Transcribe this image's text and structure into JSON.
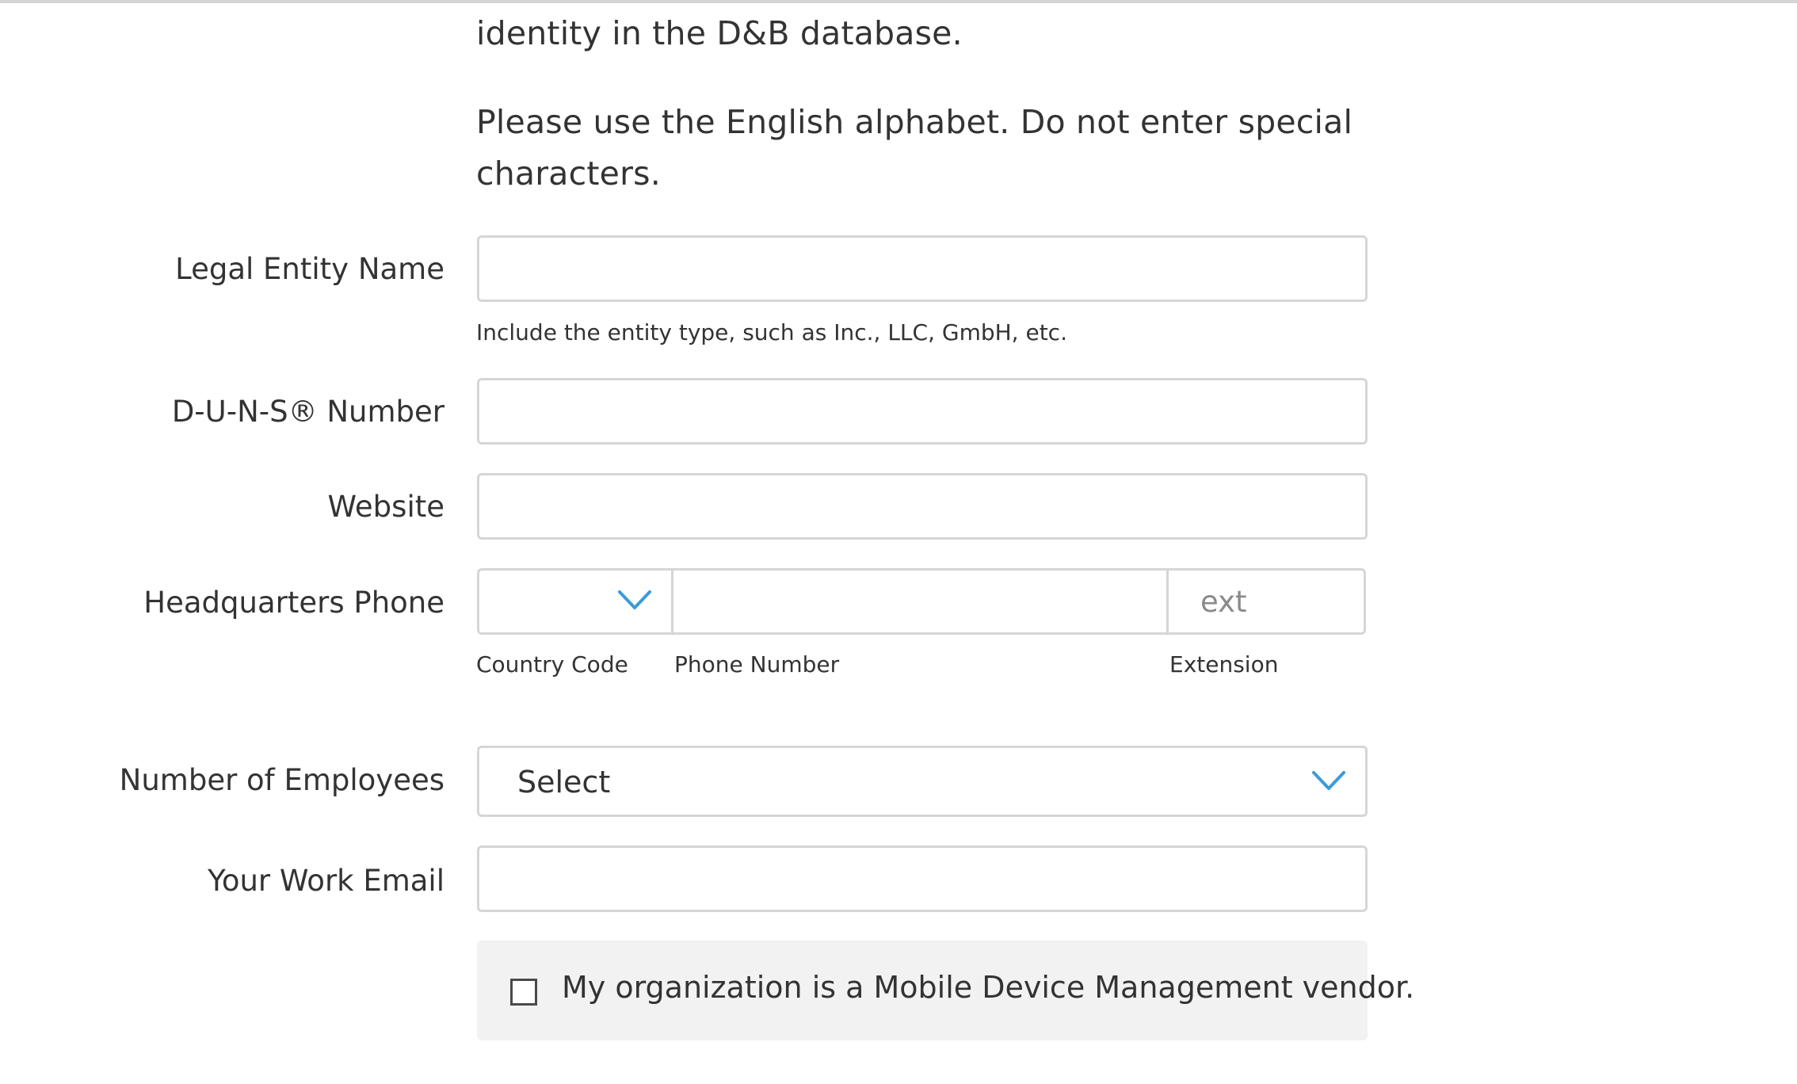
{
  "intro": {
    "line1": "identity in the D&B database.",
    "line2": "Please use the English alphabet. Do not enter special",
    "line3": "characters."
  },
  "form": {
    "legal_entity_name": {
      "label": "Legal Entity Name",
      "value": "",
      "hint": "Include the entity type, such as Inc., LLC, GmbH, etc."
    },
    "duns_number": {
      "label": "D-U-N-S® Number",
      "value": ""
    },
    "website": {
      "label": "Website",
      "value": ""
    },
    "headquarters_phone": {
      "label": "Headquarters Phone",
      "country_code_value": "",
      "phone_number_value": "",
      "extension_placeholder": "ext",
      "country_code_caption": "Country Code",
      "phone_number_caption": "Phone Number",
      "extension_caption": "Extension"
    },
    "number_of_employees": {
      "label": "Number of Employees",
      "selected": "Select"
    },
    "work_email": {
      "label": "Your Work Email",
      "value": ""
    },
    "mdm_vendor": {
      "label": "My organization is a Mobile Device Management vendor.",
      "checked": false
    }
  },
  "icons": {
    "dropdown": "chevron-down-icon"
  },
  "colors": {
    "accent": "#3a9bd9",
    "border": "#d6d6d6",
    "text": "#333333",
    "panel_bg": "#f2f2f2"
  }
}
